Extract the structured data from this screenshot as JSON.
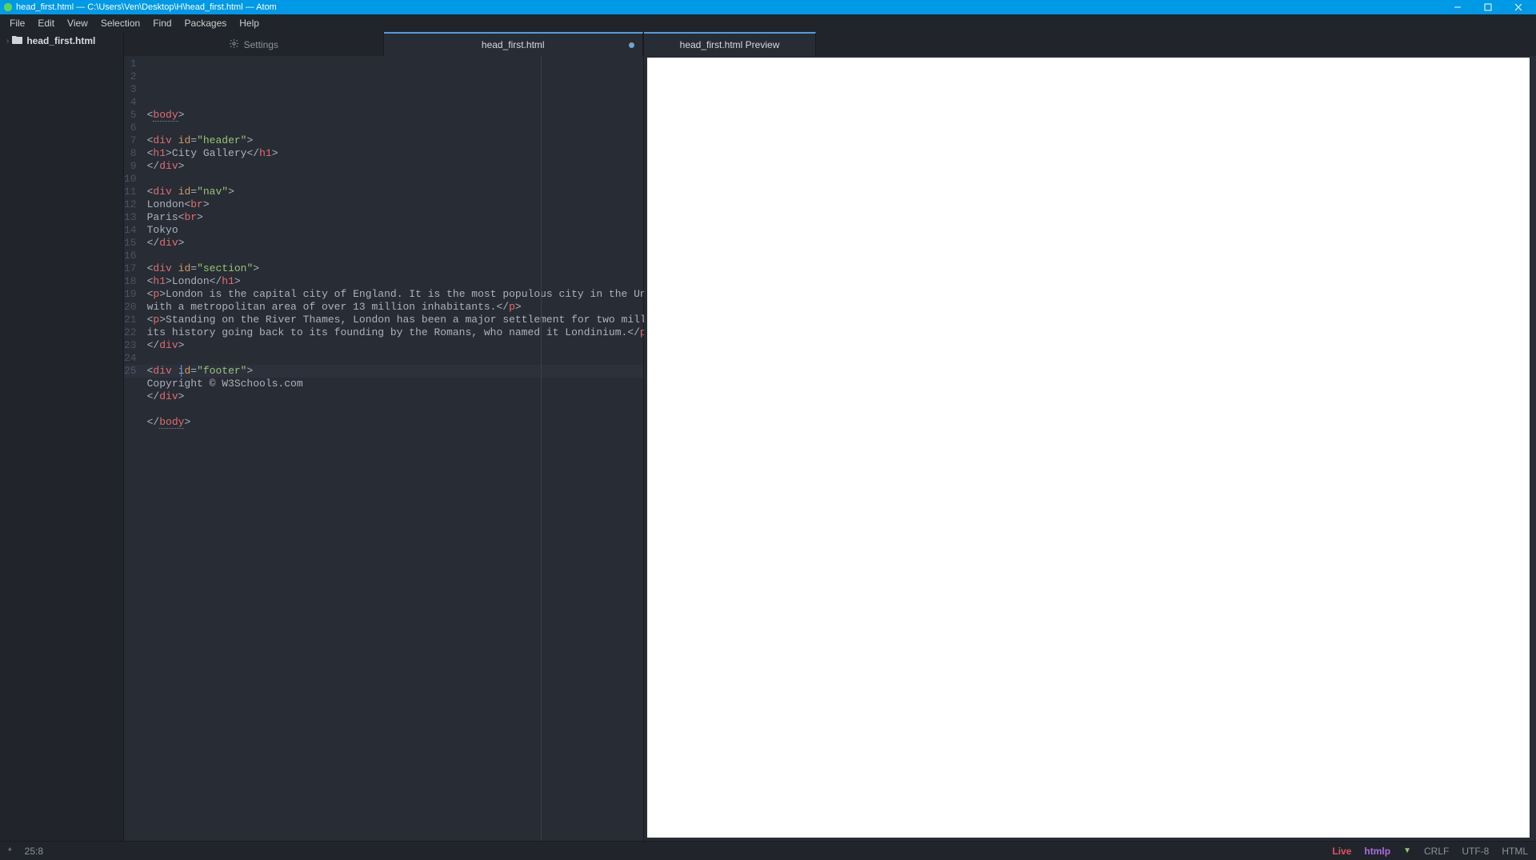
{
  "titlebar": {
    "text": "head_first.html — C:\\Users\\Ven\\Desktop\\H\\head_first.html — Atom",
    "minimize": "_",
    "maximize": "❐",
    "close": "✕"
  },
  "menubar": [
    "File",
    "Edit",
    "View",
    "Selection",
    "Find",
    "Packages",
    "Help"
  ],
  "sidebar": {
    "project_file": "head_first.html"
  },
  "tabs_left": {
    "settings": "Settings",
    "editor": "head_first.html"
  },
  "tabs_right": {
    "preview": "head_first.html Preview"
  },
  "statusbar": {
    "modified": "*",
    "cursor_pos": "25:8",
    "live": "Live",
    "htmlp": "htmlp",
    "lineend": "CRLF",
    "encoding": "UTF-8",
    "grammar": "HTML"
  },
  "code": {
    "line_count": 25,
    "lines_render": [
      {
        "n": 1,
        "html": "<span class='p'>&lt;</span><span class='bd'>body</span><span class='p'>&gt;</span>"
      },
      {
        "n": 2,
        "html": ""
      },
      {
        "n": 3,
        "html": "<span class='p'>&lt;</span><span class='tg'>div</span> <span class='at'>id</span><span class='p'>=</span><span class='st'>\"header\"</span><span class='p'>&gt;</span>"
      },
      {
        "n": 4,
        "html": "<span class='p'>&lt;</span><span class='tg'>h1</span><span class='p'>&gt;</span><span class='tx'>City Gallery</span><span class='p'>&lt;/</span><span class='tg'>h1</span><span class='p'>&gt;</span>"
      },
      {
        "n": 5,
        "html": "<span class='p'>&lt;/</span><span class='tg'>div</span><span class='p'>&gt;</span>"
      },
      {
        "n": 6,
        "html": ""
      },
      {
        "n": 7,
        "html": "<span class='p'>&lt;</span><span class='tg'>div</span> <span class='at'>id</span><span class='p'>=</span><span class='st'>\"nav\"</span><span class='p'>&gt;</span>"
      },
      {
        "n": 8,
        "html": "<span class='tx'>London</span><span class='p'>&lt;</span><span class='tg'>br</span><span class='p'>&gt;</span>"
      },
      {
        "n": 9,
        "html": "<span class='tx'>Paris</span><span class='p'>&lt;</span><span class='tg'>br</span><span class='p'>&gt;</span>"
      },
      {
        "n": 10,
        "html": "<span class='tx'>Tokyo</span>"
      },
      {
        "n": 11,
        "html": "<span class='p'>&lt;/</span><span class='tg'>div</span><span class='p'>&gt;</span>"
      },
      {
        "n": 12,
        "html": ""
      },
      {
        "n": 13,
        "html": "<span class='p'>&lt;</span><span class='tg'>div</span> <span class='at'>id</span><span class='p'>=</span><span class='st'>\"section\"</span><span class='p'>&gt;</span>"
      },
      {
        "n": 14,
        "html": "<span class='p'>&lt;</span><span class='tg'>h1</span><span class='p'>&gt;</span><span class='tx'>London</span><span class='p'>&lt;/</span><span class='tg'>h1</span><span class='p'>&gt;</span>"
      },
      {
        "n": 15,
        "html": "<span class='p'>&lt;</span><span class='tg'>p</span><span class='p'>&gt;</span><span class='tx'>London is the capital city of England. It is the most populous city in the United Kingdom,</span>"
      },
      {
        "n": 16,
        "html": "<span class='tx'>with a metropolitan area of over 13 million inhabitants.</span><span class='p'>&lt;/</span><span class='tg'>p</span><span class='p'>&gt;</span>"
      },
      {
        "n": 17,
        "html": "<span class='p'>&lt;</span><span class='tg'>p</span><span class='p'>&gt;</span><span class='tx'>Standing on the River Thames, London has been a major settlement for two millennia,</span>"
      },
      {
        "n": 18,
        "html": "<span class='tx'>its history going back to its founding by the Romans, who named it Londinium.</span><span class='p'>&lt;/</span><span class='tg'>p</span><span class='p'>&gt;</span>"
      },
      {
        "n": 19,
        "html": "<span class='p'>&lt;/</span><span class='tg'>div</span><span class='p'>&gt;</span>"
      },
      {
        "n": 20,
        "html": ""
      },
      {
        "n": 21,
        "html": "<span class='p'>&lt;</span><span class='tg'>div</span> <span class='at'>id</span><span class='p'>=</span><span class='st'>\"footer\"</span><span class='p'>&gt;</span>"
      },
      {
        "n": 22,
        "html": "<span class='tx'>Copyright © W3Schools.com</span>"
      },
      {
        "n": 23,
        "html": "<span class='p'>&lt;/</span><span class='tg'>div</span><span class='p'>&gt;</span>"
      },
      {
        "n": 24,
        "html": ""
      },
      {
        "n": 25,
        "html": "<span class='p'>&lt;/</span><span class='bd'>body</span><span class='p'>&gt;</span>"
      }
    ]
  }
}
